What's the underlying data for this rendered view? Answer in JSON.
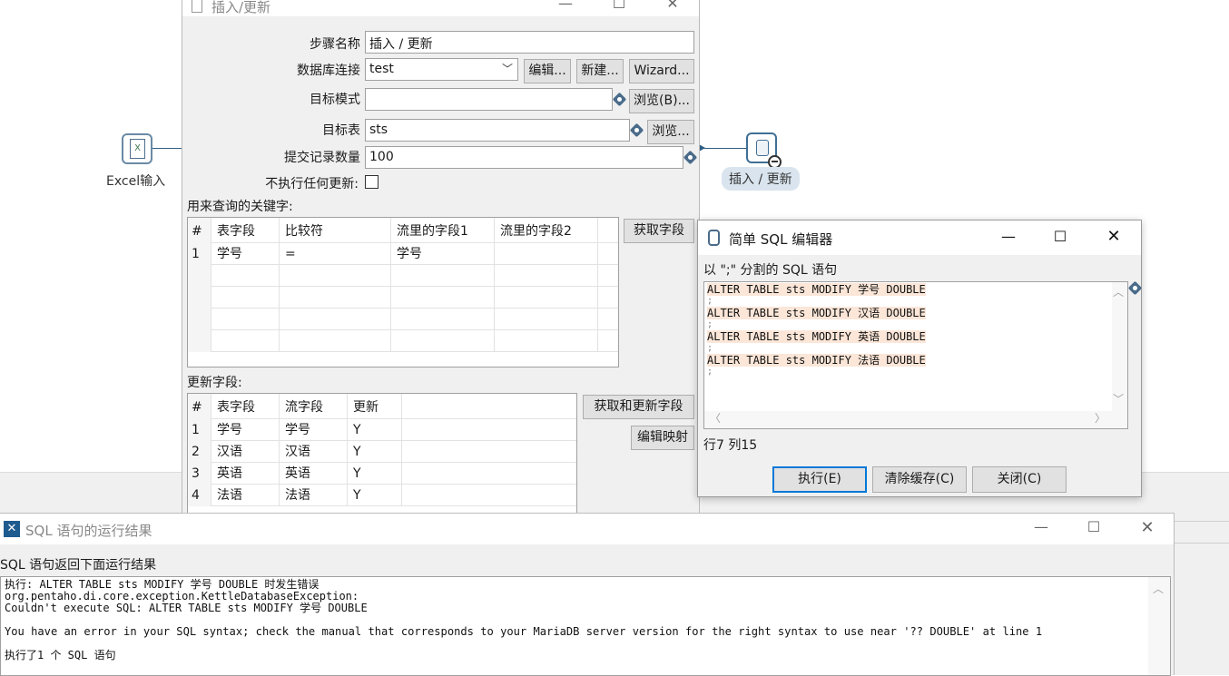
{
  "canvas": {
    "steps": [
      {
        "label": "Excel输入",
        "icon": "excel-input-icon"
      },
      {
        "label": "插入 / 更新",
        "icon": "insert-update-icon"
      }
    ]
  },
  "insert_update_dialog": {
    "title": "插入/更新",
    "step_name_label": "步骤名称",
    "step_name_value": "插入 / 更新",
    "db_conn_label": "数据库连接",
    "db_conn_value": "test",
    "edit_btn": "编辑...",
    "new_btn": "新建...",
    "wizard_btn": "Wizard...",
    "target_schema_label": "目标模式",
    "target_schema_value": "",
    "browse_b_btn": "浏览(B)...",
    "target_table_label": "目标表",
    "target_table_value": "sts",
    "browse_btn": "浏览...",
    "commit_size_label": "提交记录数量",
    "commit_size_value": "100",
    "no_update_label": "不执行任何更新:",
    "lookup_keys_label": "用来查询的关键字:",
    "get_fields_btn": "获取字段",
    "lookup_columns": [
      "#",
      "表字段",
      "比较符",
      "流里的字段1",
      "流里的字段2"
    ],
    "lookup_rows": [
      {
        "num": "1",
        "table_field": "学号",
        "comparator": "=",
        "stream1": "学号",
        "stream2": ""
      }
    ],
    "update_fields_label": "更新字段:",
    "get_update_fields_btn": "获取和更新字段",
    "edit_mapping_btn": "编辑映射",
    "update_columns": [
      "#",
      "表字段",
      "流字段",
      "更新"
    ],
    "update_rows": [
      {
        "num": "1",
        "table_field": "学号",
        "stream_field": "学号",
        "update": "Y"
      },
      {
        "num": "2",
        "table_field": "汉语",
        "stream_field": "汉语",
        "update": "Y"
      },
      {
        "num": "3",
        "table_field": "英语",
        "stream_field": "英语",
        "update": "Y"
      },
      {
        "num": "4",
        "table_field": "法语",
        "stream_field": "法语",
        "update": "Y"
      }
    ]
  },
  "sql_editor": {
    "title": "简单 SQL 编辑器",
    "prompt": "以 \";\" 分割的 SQL 语句",
    "statements": [
      "ALTER TABLE sts MODIFY 学号 DOUBLE",
      "ALTER TABLE sts MODIFY 汉语 DOUBLE",
      "ALTER TABLE sts MODIFY 英语 DOUBLE",
      "ALTER TABLE sts MODIFY 法语 DOUBLE"
    ],
    "semicolon": ";",
    "cursor_pos": "行7 列15",
    "execute_btn": "执行(E)",
    "clear_cache_btn": "清除缓存(C)",
    "close_btn": "关闭(C)"
  },
  "results_window": {
    "title": "SQL 语句的运行结果",
    "subtitle": "SQL 语句返回下面运行结果",
    "lines": [
      "执行: ALTER TABLE sts MODIFY 学号 DOUBLE 时发生错误",
      "org.pentaho.di.core.exception.KettleDatabaseException:",
      "Couldn't execute SQL: ALTER TABLE sts MODIFY 学号 DOUBLE",
      "",
      "You have an error in your SQL syntax; check the manual that corresponds to your MariaDB server version for the right syntax to use near '?? DOUBLE' at line 1",
      "",
      "执行了1 个 SQL 语句"
    ]
  },
  "colors": {
    "hop": "#2d5d84",
    "sql_highlight": "#fbe6d8",
    "accent_button_border": "#0078d7",
    "dialog_bg": "#f0f0f0"
  }
}
